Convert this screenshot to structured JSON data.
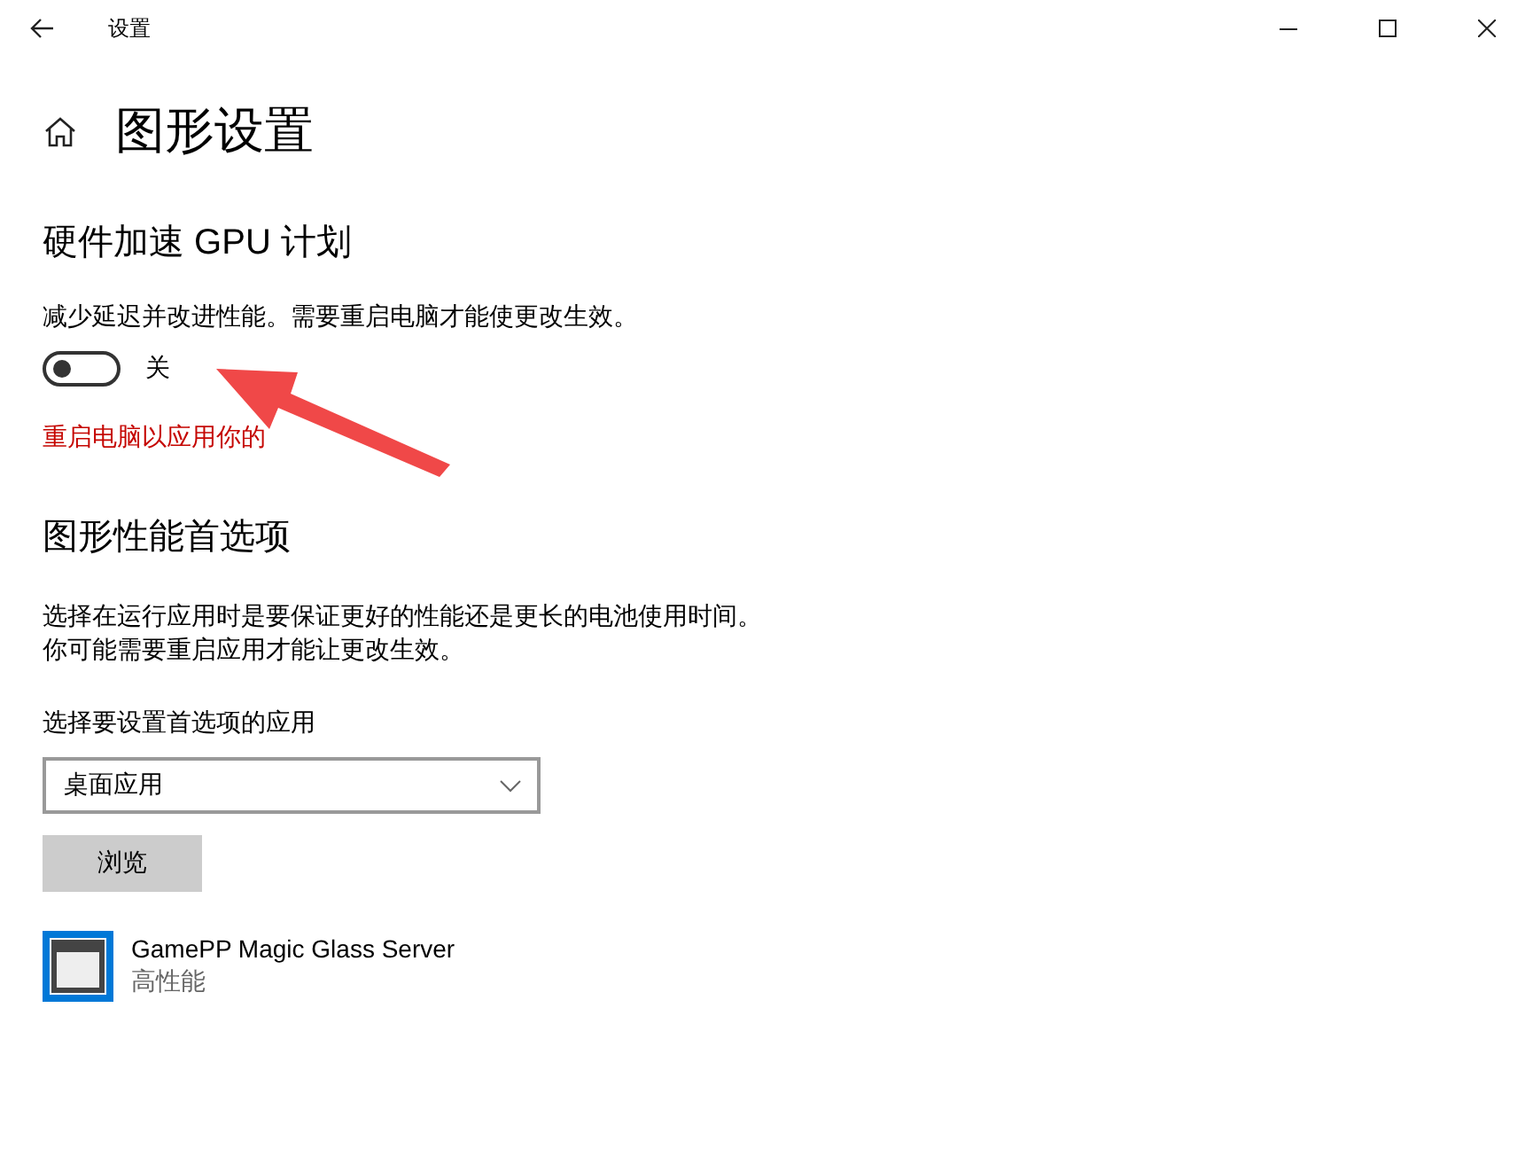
{
  "window": {
    "title": "设置"
  },
  "page": {
    "title": "图形设置"
  },
  "gpu_section": {
    "title": "硬件加速 GPU 计划",
    "description": "减少延迟并改进性能。需要重启电脑才能使更改生效。",
    "toggle": {
      "on": false,
      "label": "关"
    },
    "notice": "重启电脑以应用你的"
  },
  "performance_section": {
    "title": "图形性能首选项",
    "description": [
      "选择在运行应用时是要保证更好的性能还是更长的电池使用时间。",
      "你可能需要重启应用才能让更改生效。"
    ],
    "picker_label": "选择要设置首选项的应用",
    "dropdown": {
      "value": "桌面应用"
    },
    "browse_button": "浏览",
    "apps": [
      {
        "name": "GamePP Magic Glass Server",
        "preference": "高性能"
      }
    ]
  }
}
